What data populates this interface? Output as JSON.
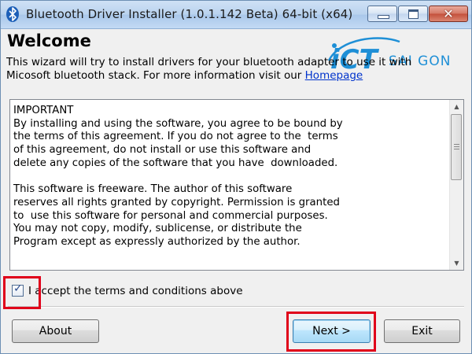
{
  "window": {
    "title": "Bluetooth Driver Installer (1.0.1.142 Beta) 64-bit (x64)",
    "controls": {
      "minimize": "minimize",
      "maximize": "maximize",
      "close": "✕"
    }
  },
  "header": {
    "heading": "Welcome",
    "intro_text": "This wizard will try to install drivers for your bluetooth adapter to use it with Micosoft bluetooth stack.   For more information visit our ",
    "homepage_link": "Homepage"
  },
  "watermark": {
    "brand_main": "iCT",
    "brand_sub": "SAI GON",
    "brand_color": "#1e8fd6"
  },
  "license": {
    "text": "IMPORTANT\nBy installing and using the software, you agree to be bound by\nthe terms of this agreement. If you do not agree to the  terms\nof this agreement, do not install or use this software and\ndelete any copies of the software that you have  downloaded.\n\nThis software is freeware. The author of this software\nreserves all rights granted by copyright. Permission is granted\nto  use this software for personal and commercial purposes.\nYou may not copy, modify, sublicense, or distribute the\nProgram except as expressly authorized by the author."
  },
  "accept": {
    "label": "I accept the terms and conditions above",
    "checked": true
  },
  "buttons": {
    "about": "About",
    "next": "Next >",
    "exit": "Exit"
  },
  "colors": {
    "highlight": "#e0001a",
    "link": "#0033cc"
  }
}
